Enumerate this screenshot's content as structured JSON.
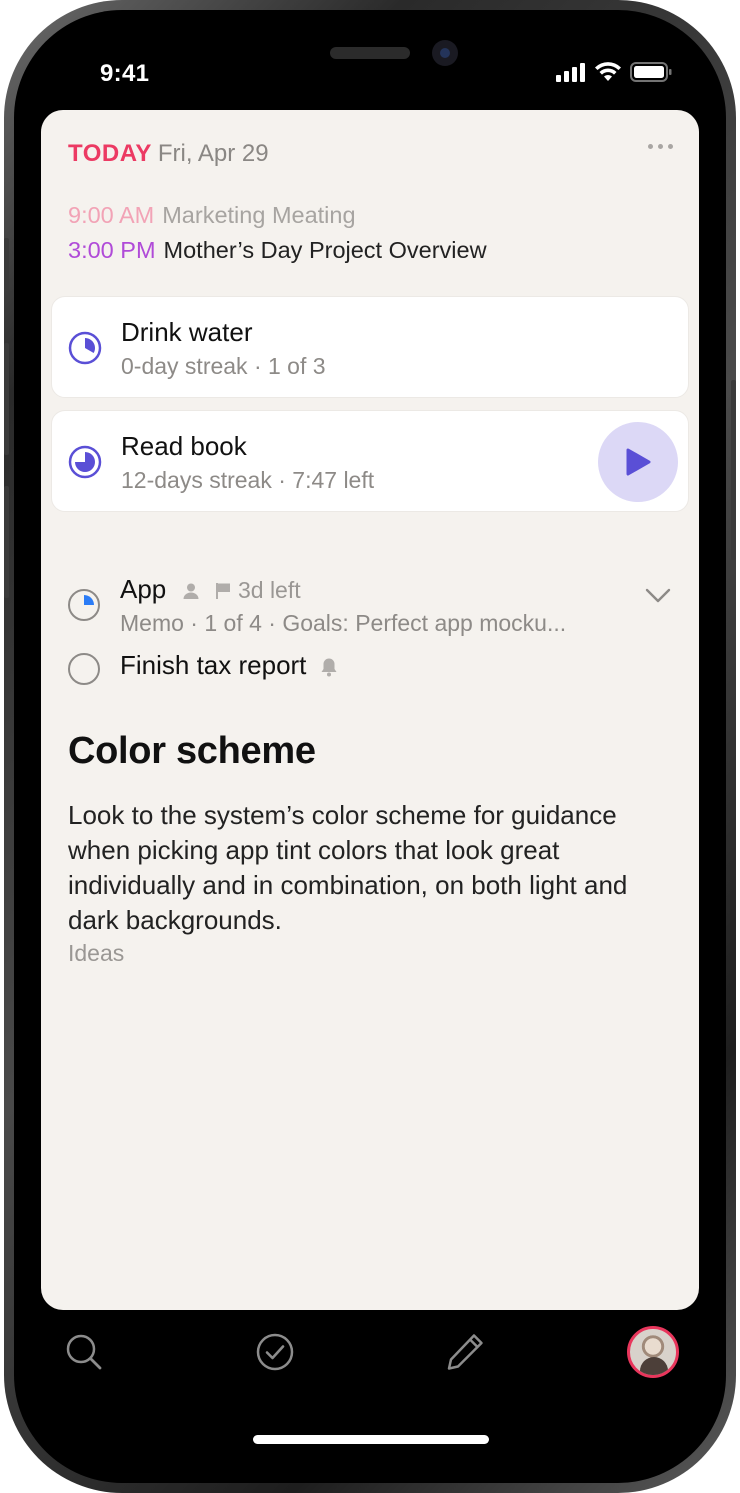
{
  "status_bar": {
    "time": "9:41"
  },
  "header": {
    "today_label": "TODAY",
    "date": "Fri, Apr 29"
  },
  "events": [
    {
      "time": "9:00 AM",
      "title": "Marketing Meating"
    },
    {
      "time": "3:00 PM",
      "title": "Mother’s Day Project Overview"
    }
  ],
  "habits": [
    {
      "title": "Drink water",
      "subtitle": "0-day streak · 1 of 3",
      "progress": 0.33
    },
    {
      "title": "Read book",
      "subtitle": "12-days streak · 7:47 left",
      "progress": 0.75
    }
  ],
  "tasks": [
    {
      "title": "App",
      "meta": "3d left",
      "subtitle": "Memo · 1 of 4 · Goals: Perfect app mocku...",
      "progress": 0.25
    },
    {
      "title": "Finish tax report"
    }
  ],
  "note": {
    "title": "Color scheme",
    "body": "Look to the system’s color scheme for guidance when picking app tint colors that look great individually and in combination, on both light and dark backgrounds.",
    "tag": "Ideas"
  },
  "colors": {
    "accent_red": "#ec3a63",
    "accent_purple": "#5a4fd6",
    "card_bg": "#f5f2ee",
    "progress_blue": "#2b7cf6"
  },
  "tab_bar": {
    "items": [
      "search-icon",
      "checkmark-circle-icon",
      "pencil-icon",
      "avatar"
    ]
  }
}
